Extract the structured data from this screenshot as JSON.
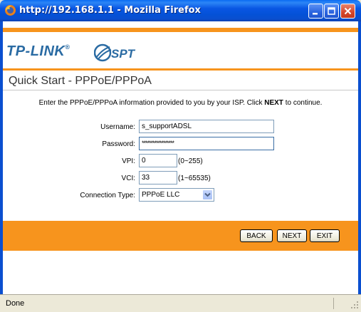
{
  "window": {
    "title": "http://192.168.1.1 - Mozilla Firefox"
  },
  "logos": {
    "tplink_text": "TP-LINK",
    "tplink_reg": "®",
    "spt_text": "SPT"
  },
  "page": {
    "title": "Quick Start - PPPoE/PPPoA",
    "instruction_prefix": "Enter the PPPoE/PPPoA information provided to you by your ISP. Click ",
    "instruction_bold": "NEXT",
    "instruction_suffix": " to continue."
  },
  "form": {
    "username_label": "Username:",
    "username_value": "s_supportADSL",
    "password_label": "Password:",
    "password_value": "******************",
    "vpi_label": "VPI:",
    "vpi_value": "0",
    "vpi_hint": "(0~255)",
    "vci_label": "VCI:",
    "vci_value": "33",
    "vci_hint": "(1~65535)",
    "connection_type_label": "Connection Type:",
    "connection_type_value": "PPPoE LLC"
  },
  "buttons": {
    "back": "BACK",
    "next": "NEXT",
    "exit": "EXIT"
  },
  "statusbar": {
    "text": "Done"
  },
  "colors": {
    "accent_orange": "#f7941d",
    "xp_blue": "#0a4fd0",
    "tplink_blue": "#2a6ba3"
  }
}
